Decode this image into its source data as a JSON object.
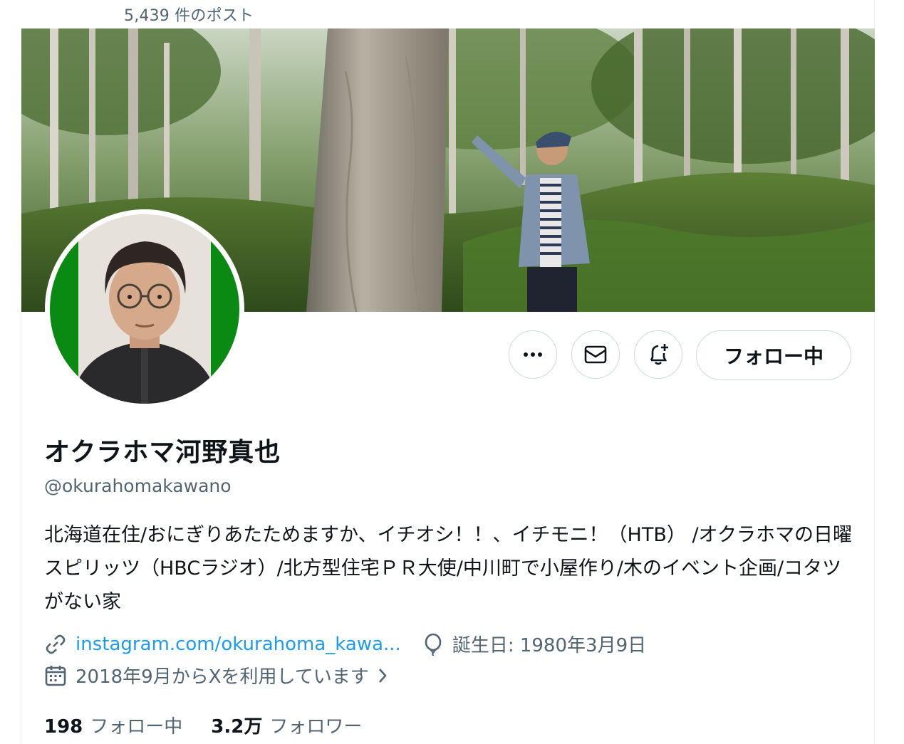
{
  "header": {
    "post_count": "5,439 件のポスト"
  },
  "profile": {
    "display_name": "オクラホマ河野真也",
    "handle": "@okurahomakawano",
    "bio": "北海道在住/おにぎりあたためますか、イチオシ！！、イチモニ！（HTB） /オクラホマの日曜スピリッツ（HBCラジオ）/北方型住宅ＰＲ大使/中川町で小屋作り/木のイベント企画/コタツがない家",
    "website": "instagram.com/okurahoma_kawa...",
    "birthday": "誕生日: 1980年3月9日",
    "joined": "2018年9月からXを利用しています",
    "following_count": "198",
    "following_label": "フォロー中",
    "followers_count": "3.2万",
    "followers_label": "フォロワー"
  },
  "actions": {
    "follow_button": "フォロー中",
    "more_icon": "more-horizontal-icon",
    "message_icon": "mail-icon",
    "notify_icon": "bell-plus-icon"
  },
  "colors": {
    "link": "#1d9bf0",
    "secondary_text": "#536471",
    "border": "#cfd9de"
  }
}
